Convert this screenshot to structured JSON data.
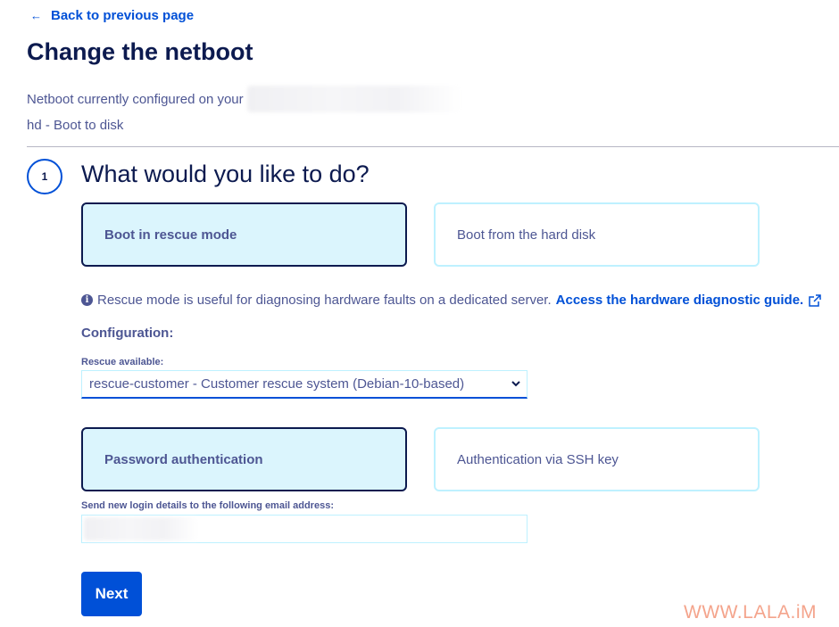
{
  "nav": {
    "back_label": "Back to previous page",
    "back_icon": "arrow-left-icon"
  },
  "page": {
    "title": "Change the netboot",
    "netboot_prefix": "Netboot currently configured on your",
    "current_netboot": "hd - Boot to disk"
  },
  "step": {
    "number": "1",
    "title": "What would you like to do?"
  },
  "boot_options": [
    {
      "label": "Boot in rescue mode",
      "selected": true
    },
    {
      "label": "Boot from the hard disk",
      "selected": false
    }
  ],
  "info": {
    "text": "Rescue mode is useful for diagnosing hardware faults on a dedicated server.",
    "link_label": "Access the hardware diagnostic guide."
  },
  "configuration": {
    "heading": "Configuration:",
    "rescue_label": "Rescue available:",
    "rescue_selected": "rescue-customer - Customer rescue system (Debian-10-based)"
  },
  "auth_options": [
    {
      "label": "Password authentication",
      "selected": true
    },
    {
      "label": "Authentication via SSH key",
      "selected": false
    }
  ],
  "email": {
    "label": "Send new login details to the following email address:"
  },
  "actions": {
    "next_label": "Next"
  },
  "watermark": "WWW.LALA.iM",
  "colors": {
    "primary": "#0050d7",
    "navy": "#0c1a4f",
    "text": "#4d5693",
    "tile_selected_bg": "#dbf5fd",
    "tile_border": "#bef1ff"
  }
}
